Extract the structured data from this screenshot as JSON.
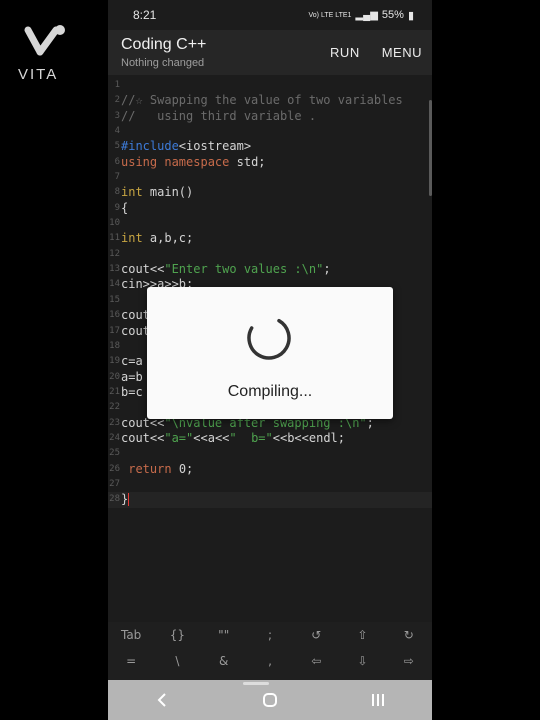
{
  "watermark": {
    "text": "VITA"
  },
  "status_bar": {
    "time": "8:21",
    "network": "Vo) LTE LTE1",
    "battery": "55%"
  },
  "app_bar": {
    "title": "Coding C++",
    "subtitle": "Nothing changed",
    "run_label": "RUN",
    "menu_label": "MENU"
  },
  "editor": {
    "lines": [
      {
        "n": "1",
        "tokens": []
      },
      {
        "n": "2",
        "tokens": [
          {
            "t": "//☆ Swapping the value of two variables",
            "c": "comment"
          }
        ]
      },
      {
        "n": "3",
        "tokens": [
          {
            "t": "//   using third variable .",
            "c": "comment"
          }
        ]
      },
      {
        "n": "4",
        "tokens": []
      },
      {
        "n": "5",
        "tokens": [
          {
            "t": "#include",
            "c": "pre"
          },
          {
            "t": "<iostream>",
            "c": "plain"
          }
        ]
      },
      {
        "n": "6",
        "tokens": [
          {
            "t": "using",
            "c": "kw"
          },
          {
            "t": " ",
            "c": "plain"
          },
          {
            "t": "namespace",
            "c": "kw"
          },
          {
            "t": " std;",
            "c": "plain"
          }
        ]
      },
      {
        "n": "7",
        "tokens": []
      },
      {
        "n": "8",
        "tokens": [
          {
            "t": "int",
            "c": "type"
          },
          {
            "t": " main()",
            "c": "plain"
          }
        ]
      },
      {
        "n": "9",
        "tokens": [
          {
            "t": "{",
            "c": "plain"
          }
        ]
      },
      {
        "n": "10",
        "tokens": []
      },
      {
        "n": "11",
        "tokens": [
          {
            "t": "int",
            "c": "type"
          },
          {
            "t": " a,b,c;",
            "c": "plain"
          }
        ]
      },
      {
        "n": "12",
        "tokens": []
      },
      {
        "n": "13",
        "tokens": [
          {
            "t": "cout<<",
            "c": "plain"
          },
          {
            "t": "\"Enter two values :\\n\"",
            "c": "str"
          },
          {
            "t": ";",
            "c": "plain"
          }
        ]
      },
      {
        "n": "14",
        "tokens": [
          {
            "t": "cin>>a>>b;",
            "c": "plain"
          }
        ]
      },
      {
        "n": "15",
        "tokens": []
      },
      {
        "n": "16",
        "tokens": [
          {
            "t": "cout",
            "c": "plain"
          }
        ]
      },
      {
        "n": "17",
        "tokens": [
          {
            "t": "cout",
            "c": "plain"
          }
        ]
      },
      {
        "n": "18",
        "tokens": []
      },
      {
        "n": "19",
        "tokens": [
          {
            "t": "c=a",
            "c": "plain"
          }
        ]
      },
      {
        "n": "20",
        "tokens": [
          {
            "t": "a=b",
            "c": "plain"
          }
        ]
      },
      {
        "n": "21",
        "tokens": [
          {
            "t": "b=c",
            "c": "plain"
          }
        ]
      },
      {
        "n": "22",
        "tokens": []
      },
      {
        "n": "23",
        "tokens": [
          {
            "t": "cout<<",
            "c": "plain"
          },
          {
            "t": "\"\\nvalue after swapping :\\n\"",
            "c": "str"
          },
          {
            "t": ";",
            "c": "plain"
          }
        ]
      },
      {
        "n": "24",
        "tokens": [
          {
            "t": "cout<<",
            "c": "plain"
          },
          {
            "t": "\"a=\"",
            "c": "str"
          },
          {
            "t": "<<a<<",
            "c": "plain"
          },
          {
            "t": "\"  b=\"",
            "c": "str"
          },
          {
            "t": "<<b<<endl;",
            "c": "plain"
          }
        ]
      },
      {
        "n": "25",
        "tokens": []
      },
      {
        "n": "26",
        "tokens": [
          {
            "t": " ",
            "c": "plain"
          },
          {
            "t": "return",
            "c": "kw"
          },
          {
            "t": " 0;",
            "c": "plain"
          }
        ]
      },
      {
        "n": "27",
        "tokens": []
      },
      {
        "n": "28",
        "tokens": [
          {
            "t": "}",
            "c": "plain"
          }
        ],
        "active": true,
        "caret": true
      }
    ]
  },
  "dialog": {
    "text": "Compiling..."
  },
  "toolbar": {
    "row1": [
      "Tab",
      "{}",
      "\"\"",
      ";",
      "↺",
      "⇧",
      "↻"
    ],
    "row2": [
      "=",
      "\\",
      "&",
      ",",
      "⇦",
      "⇩",
      "⇨"
    ]
  },
  "nav_bar": {
    "back": "‹",
    "home": "○",
    "recents": "|||"
  },
  "colors": {
    "background": "#1c1c1c",
    "comment": "#6b6b6b",
    "preprocessor": "#3d7bd9",
    "keyword": "#c76b4b",
    "type": "#c7a542",
    "string": "#4fa34f",
    "caret": "#e53935"
  }
}
